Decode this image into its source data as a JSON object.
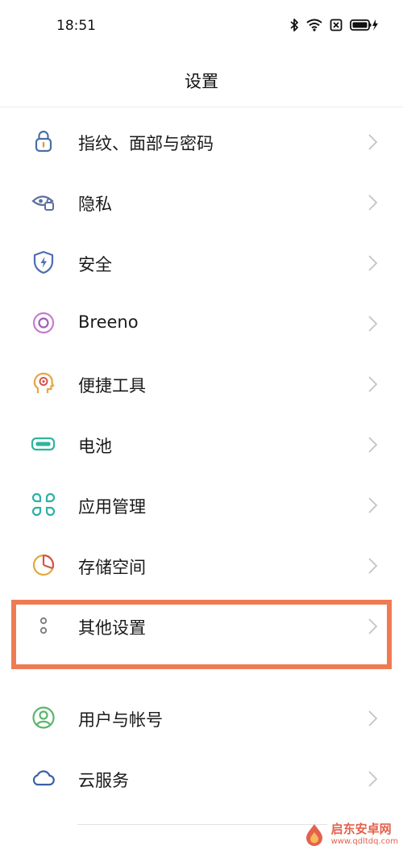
{
  "status_bar": {
    "time": "18:51",
    "icons": [
      "bluetooth-icon",
      "wifi-icon",
      "sim-icon",
      "battery-charging-icon"
    ]
  },
  "header": {
    "title": "设置"
  },
  "settings": {
    "items": [
      {
        "label": "指纹、面部与密码",
        "icon": "lock-icon",
        "color": "#4a6fa5"
      },
      {
        "label": "隐私",
        "icon": "privacy-eye-icon",
        "color": "#5b6fa0"
      },
      {
        "label": "安全",
        "icon": "security-shield-icon",
        "color": "#4f6db0"
      },
      {
        "label": "Breeno",
        "icon": "breeno-icon",
        "color": "#b66bc6"
      },
      {
        "label": "便捷工具",
        "icon": "convenience-tools-icon",
        "color": "#e6a545"
      },
      {
        "label": "电池",
        "icon": "battery-icon",
        "color": "#2fb59c"
      },
      {
        "label": "应用管理",
        "icon": "app-management-icon",
        "color": "#2fb0a6"
      },
      {
        "label": "存储空间",
        "icon": "storage-pie-icon",
        "color": "#e0a93a"
      },
      {
        "label": "其他设置",
        "icon": "more-settings-icon",
        "color": "#777777"
      },
      {
        "label": "用户与帐号",
        "icon": "user-account-icon",
        "color": "#5bb56b"
      },
      {
        "label": "云服务",
        "icon": "cloud-icon",
        "color": "#3a5fa8"
      }
    ]
  },
  "highlight": {
    "color": "#ef7b53",
    "target": "其他设置"
  },
  "watermark": {
    "title": "启东安卓网",
    "url": "www.qdltdq.com"
  }
}
